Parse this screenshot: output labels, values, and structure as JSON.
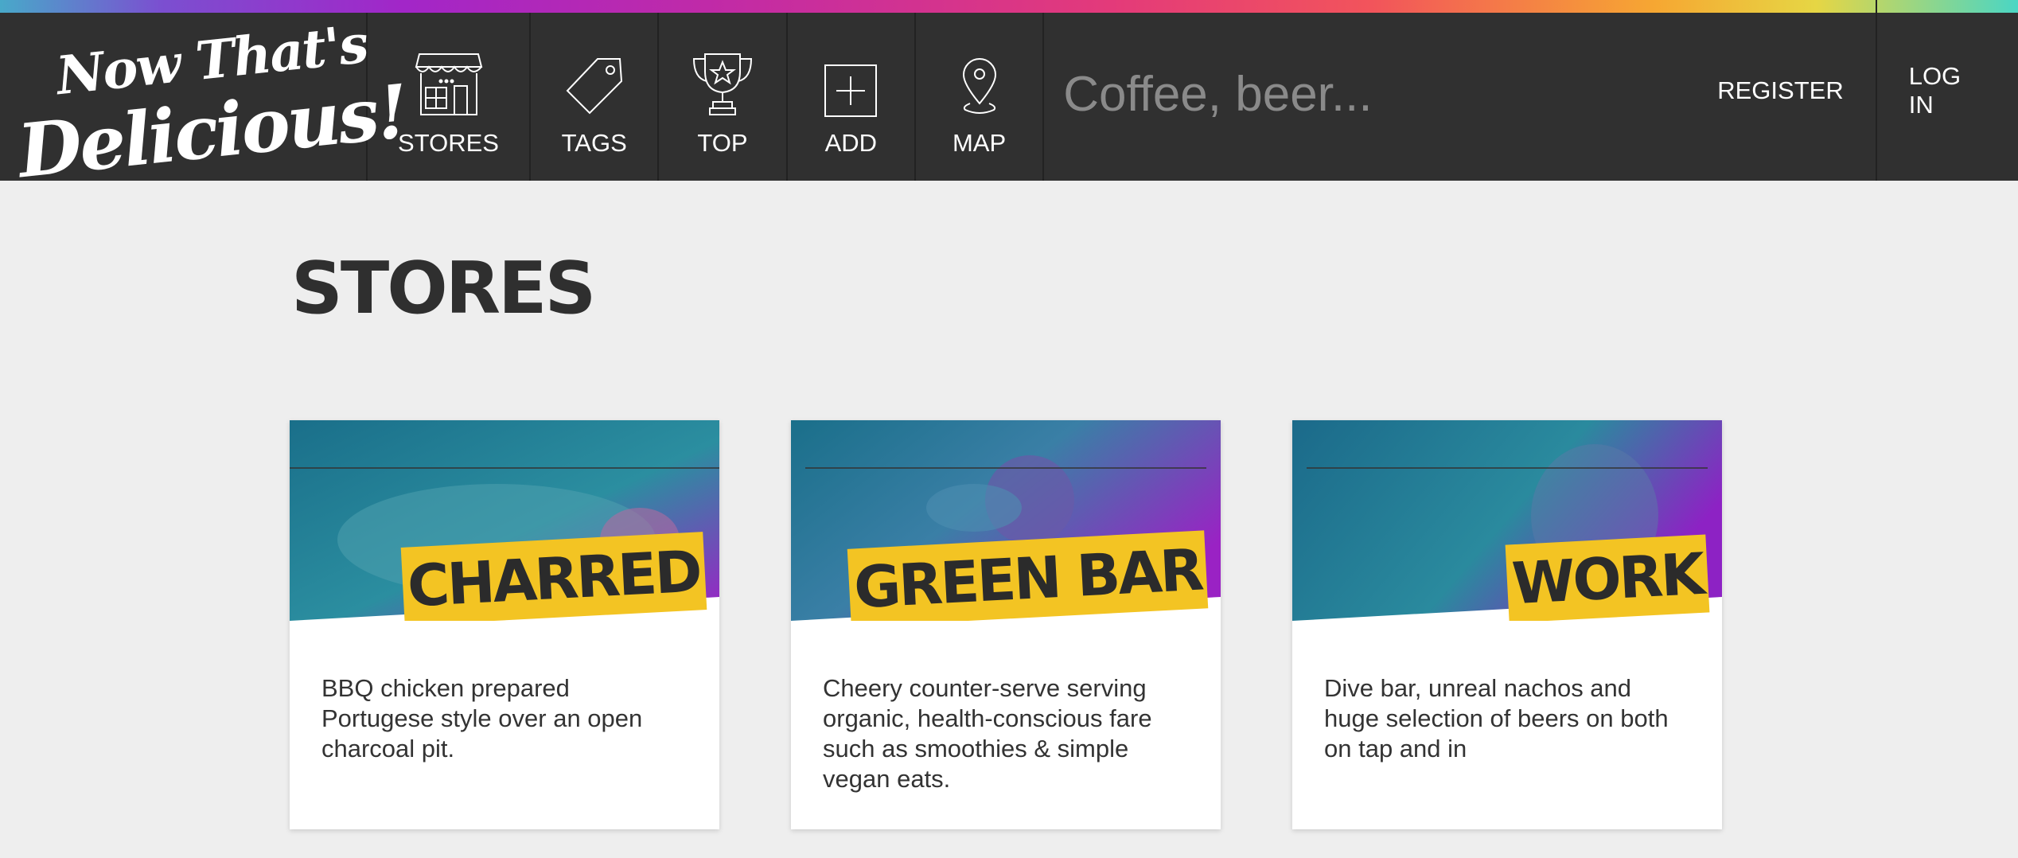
{
  "brand": {
    "line1": "Now That's",
    "line2": "Delicious!"
  },
  "nav": {
    "items": [
      {
        "label": "STORES",
        "icon": "store-icon"
      },
      {
        "label": "TAGS",
        "icon": "tag-icon"
      },
      {
        "label": "TOP",
        "icon": "trophy-icon"
      },
      {
        "label": "ADD",
        "icon": "add-icon"
      },
      {
        "label": "MAP",
        "icon": "map-pin-icon"
      }
    ],
    "search_placeholder": "Coffee, beer...",
    "register_label": "REGISTER",
    "login_label": "LOG IN"
  },
  "page": {
    "title": "STORES"
  },
  "stores": [
    {
      "name": "CHARRED",
      "description": "BBQ chicken prepared Portugese style over an open charcoal pit."
    },
    {
      "name": "GREEN BAR",
      "description": "Cheery counter-serve serving organic, health-conscious fare such as smoothies & simple vegan eats."
    },
    {
      "name": "WORK",
      "description": "Dive bar, unreal nachos and huge selection of beers on both on tap and in"
    }
  ],
  "colors": {
    "accent": "#f3c423",
    "nav_bg": "#303030",
    "page_bg": "#eeeeee"
  }
}
